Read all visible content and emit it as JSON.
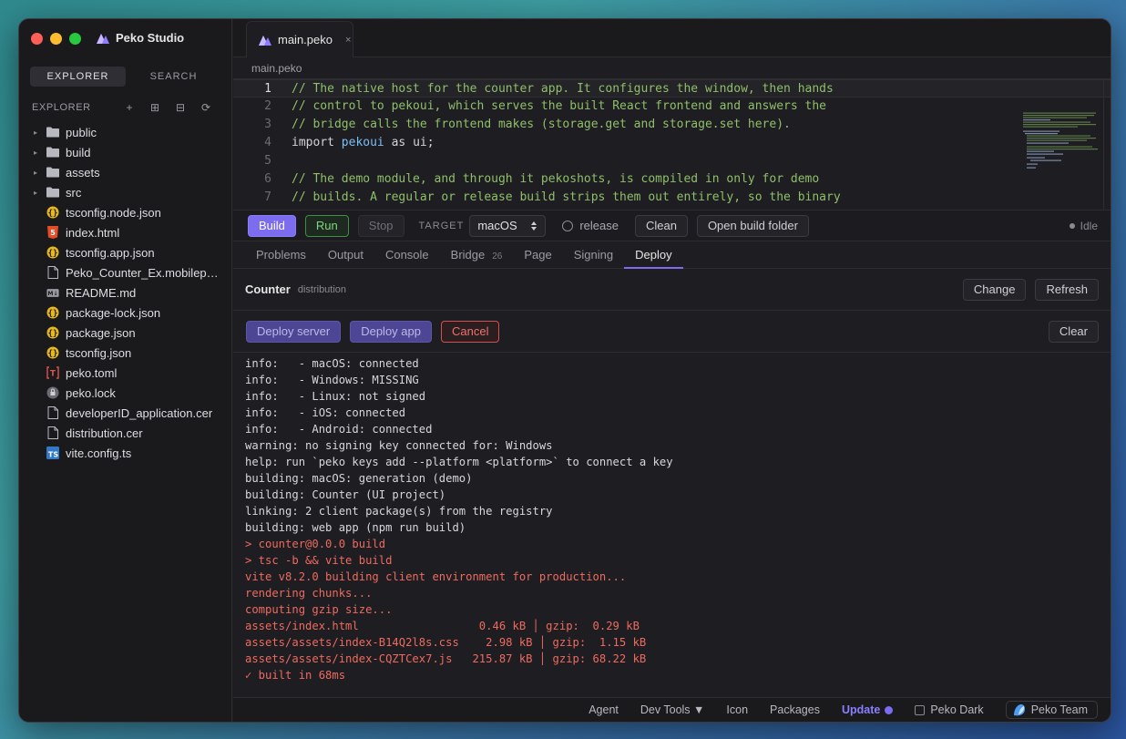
{
  "app": {
    "title": "Peko Studio"
  },
  "sidebar": {
    "tabs": [
      "EXPLORER",
      "SEARCH"
    ],
    "section_label": "EXPLORER",
    "actions": [
      "+",
      "⊞",
      "⊟",
      "⟳"
    ],
    "items": [
      {
        "name": "public",
        "kind": "folder"
      },
      {
        "name": "build",
        "kind": "folder"
      },
      {
        "name": "assets",
        "kind": "folder"
      },
      {
        "name": "src",
        "kind": "folder"
      },
      {
        "name": "tsconfig.node.json",
        "kind": "json"
      },
      {
        "name": "index.html",
        "kind": "html"
      },
      {
        "name": "tsconfig.app.json",
        "kind": "json"
      },
      {
        "name": "Peko_Counter_Ex.mobileprovision",
        "kind": "file"
      },
      {
        "name": "README.md",
        "kind": "md"
      },
      {
        "name": "package-lock.json",
        "kind": "json"
      },
      {
        "name": "package.json",
        "kind": "json"
      },
      {
        "name": "tsconfig.json",
        "kind": "json"
      },
      {
        "name": "peko.toml",
        "kind": "toml"
      },
      {
        "name": "peko.lock",
        "kind": "lock"
      },
      {
        "name": "developerID_application.cer",
        "kind": "file"
      },
      {
        "name": "distribution.cer",
        "kind": "file"
      },
      {
        "name": "vite.config.ts",
        "kind": "ts"
      }
    ]
  },
  "editor": {
    "tab": {
      "label": "main.peko",
      "close": "×"
    },
    "breadcrumb": "main.peko",
    "lines": [
      {
        "n": "1",
        "c": "// The native host for the counter app. It configures the window, then hands"
      },
      {
        "n": "2",
        "c": "// control to pekoui, which serves the built React frontend and answers the"
      },
      {
        "n": "3",
        "c": "// bridge calls the frontend makes (storage.get and storage.set here)."
      },
      {
        "n": "4",
        "kw": "import ",
        "id": "pekoui",
        "rest": " as ui;"
      },
      {
        "n": "5",
        "c": ""
      },
      {
        "n": "6",
        "c": "// The demo module, and through it pekoshots, is compiled in only for demo"
      },
      {
        "n": "7",
        "c": "// builds. A regular or release build strips them out entirely, so the binary"
      }
    ]
  },
  "toolbar": {
    "build": "Build",
    "run": "Run",
    "stop": "Stop",
    "target_label": "TARGET",
    "target_value": "macOS",
    "release": "release",
    "clean": "Clean",
    "open_folder": "Open build folder",
    "status": "Idle"
  },
  "panel": {
    "tabs": [
      {
        "label": "Problems"
      },
      {
        "label": "Output"
      },
      {
        "label": "Console"
      },
      {
        "label": "Bridge",
        "badge": "26"
      },
      {
        "label": "Page"
      },
      {
        "label": "Signing"
      },
      {
        "label": "Deploy",
        "active": true
      }
    ],
    "project": "Counter",
    "kind": "distribution",
    "change": "Change",
    "refresh": "Refresh",
    "deploy_server": "Deploy server",
    "deploy_app": "Deploy app",
    "cancel": "Cancel",
    "clear": "Clear"
  },
  "log": [
    {
      "t": "info:   - macOS: connected",
      "err": false
    },
    {
      "t": "info:   - Windows: MISSING",
      "err": false
    },
    {
      "t": "info:   - Linux: not signed",
      "err": false
    },
    {
      "t": "info:   - iOS: connected",
      "err": false
    },
    {
      "t": "info:   - Android: connected",
      "err": false
    },
    {
      "t": "warning: no signing key connected for: Windows",
      "err": false
    },
    {
      "t": "help: run `peko keys add --platform <platform>` to connect a key",
      "err": false
    },
    {
      "t": "building: macOS: generation (demo)",
      "err": false
    },
    {
      "t": "building: Counter (UI project)",
      "err": false
    },
    {
      "t": "linking: 2 client package(s) from the registry",
      "err": false
    },
    {
      "t": "building: web app (npm run build)",
      "err": false
    },
    {
      "t": "> counter@0.0.0 build",
      "err": true
    },
    {
      "t": "> tsc -b && vite build",
      "err": true
    },
    {
      "t": "vite v8.2.0 building client environment for production...",
      "err": true
    },
    {
      "t": "rendering chunks...",
      "err": true
    },
    {
      "t": "computing gzip size...",
      "err": true
    },
    {
      "t": "assets/index.html                  0.46 kB │ gzip:  0.29 kB",
      "err": true
    },
    {
      "t": "assets/assets/index-B14Q2l8s.css    2.98 kB │ gzip:  1.15 kB",
      "err": true
    },
    {
      "t": "assets/assets/index-CQZTCex7.js   215.87 kB │ gzip: 68.22 kB",
      "err": true
    },
    {
      "t": "✓ built in 68ms",
      "err": true
    }
  ],
  "footer": {
    "agent": "Agent",
    "devtools": "Dev Tools ▼",
    "icon": "Icon",
    "packages": "Packages",
    "update": "Update",
    "theme": "Peko Dark",
    "team": "Peko Team"
  }
}
